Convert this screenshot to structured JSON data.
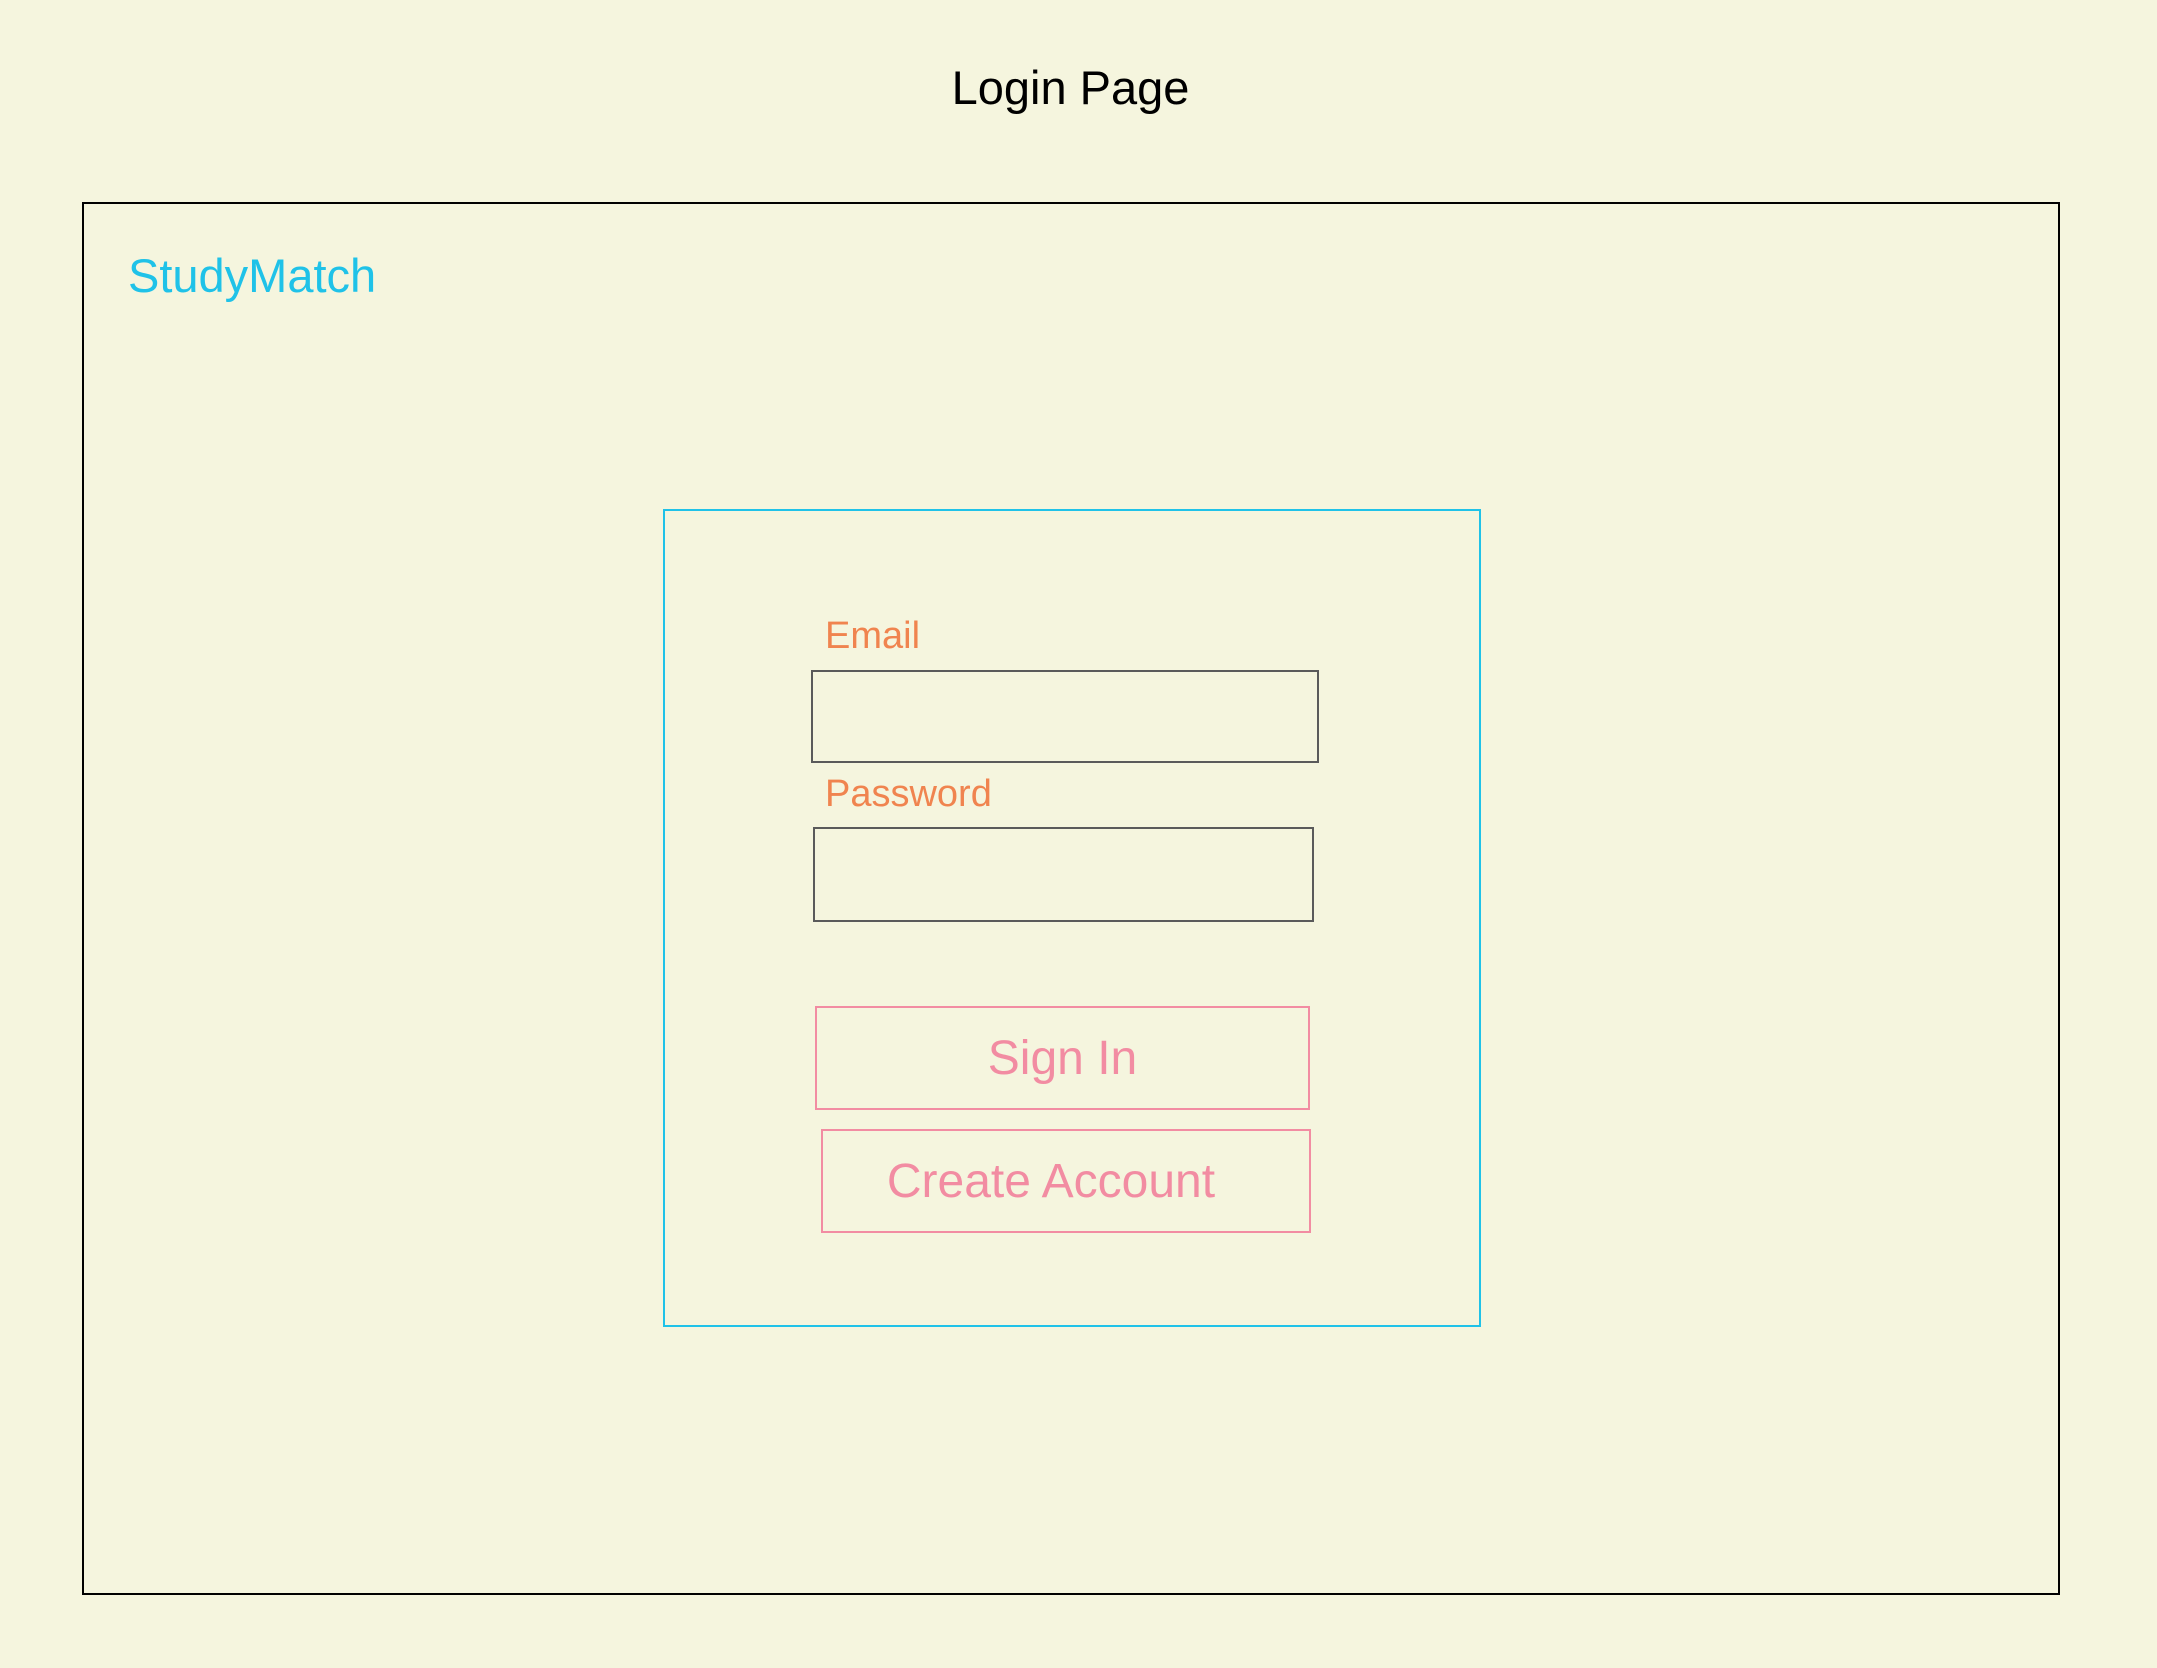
{
  "page": {
    "title": "Login Page"
  },
  "app": {
    "brand": "StudyMatch"
  },
  "login_form": {
    "email_label": "Email",
    "email_value": "",
    "password_label": "Password",
    "password_value": "",
    "sign_in_label": "Sign In",
    "create_account_label": "Create Account"
  },
  "colors": {
    "background": "#f5f5de",
    "brand": "#1fc2e8",
    "label": "#f0844f",
    "button": "#f28ca2",
    "input_border": "#5a5a5a"
  }
}
